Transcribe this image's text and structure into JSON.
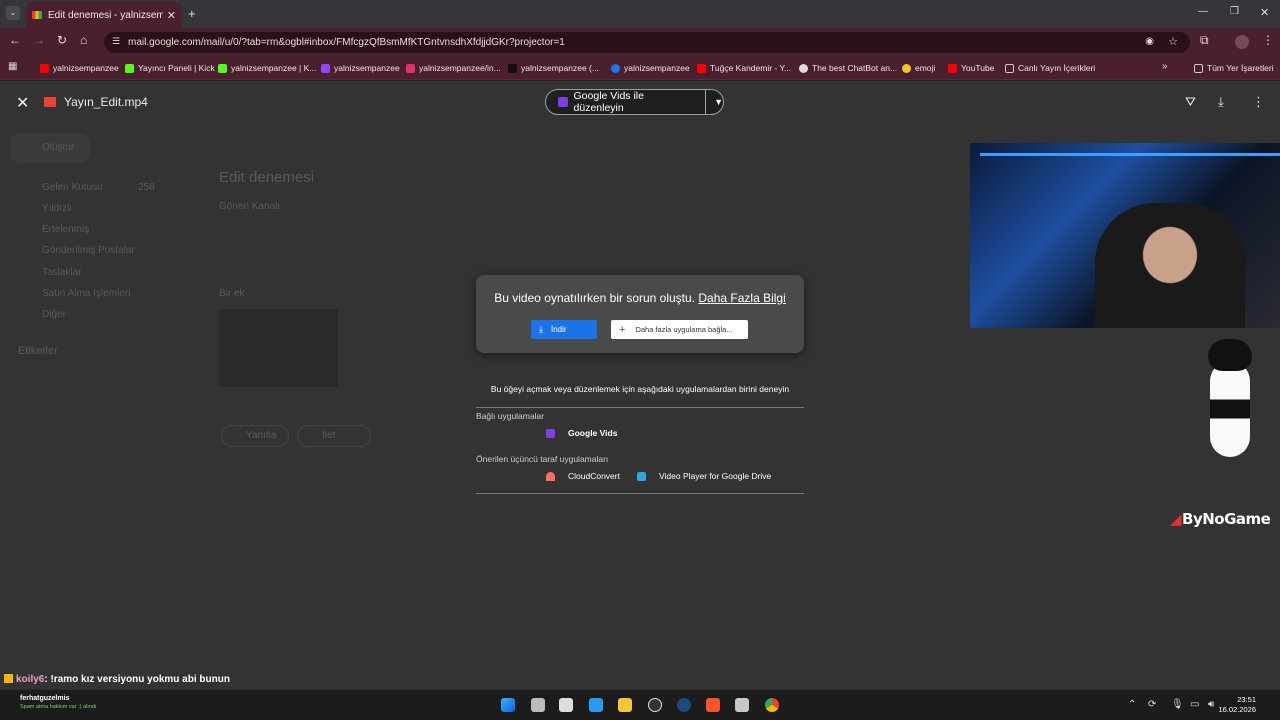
{
  "browser": {
    "tab_title": "Edit denemesi - yalnizsempanz",
    "url": "mail.google.com/mail/u/0/?tab=rm&ogbl#inbox/FMfcgzQfBsmMfKTGntvnsdhXfdjjdGKr?projector=1",
    "bookmarks": [
      {
        "label": "yalnizsempanzee",
        "color": "#ff0000"
      },
      {
        "label": "Yayıncı Paneli | Kick",
        "color": "#53fc18"
      },
      {
        "label": "yalnizsempanzee | K...",
        "color": "#53fc18"
      },
      {
        "label": "yalnizsempanzee",
        "color": "#9146ff"
      },
      {
        "label": "yalnizsempanzee/in...",
        "color": "#e1306c"
      },
      {
        "label": "yalnizsempanzee (...",
        "color": "#111111"
      },
      {
        "label": "yalnizsempanzee",
        "color": "#1877f2"
      },
      {
        "label": "Tuğçe Kandemir - Y...",
        "color": "#ff0000"
      },
      {
        "label": "The best ChatBot an...",
        "color": "#dddddd"
      },
      {
        "label": "emoji",
        "color": "#f5c518"
      },
      {
        "label": "YouTube",
        "color": "#ff0000"
      },
      {
        "label": "Canlı Yayın İçerikleri",
        "color": "#cccccc"
      }
    ],
    "all_bookmarks": "Tüm Yer İşaretleri"
  },
  "gmail_bg": {
    "compose": "Oluştur",
    "nav": [
      "Gelen Kutusu",
      "Yıldızlı",
      "Ertelenmiş",
      "Gönderilmiş Postalar",
      "Taslaklar",
      "Satın Alma İşlemleri",
      "Diğer"
    ],
    "inbox_count": "258",
    "labels": "Etiketler",
    "subject": "Edit denemesi",
    "sender": "Gönen Kanalı",
    "attachment_line": "Bir ek",
    "reply": "Yanıtla",
    "forward": "İlet"
  },
  "viewer": {
    "file_name": "Yayın_Edit.mp4",
    "open_with": "Google Vids ile düzenleyin",
    "error_message": "Bu video oynatılırken bir sorun oluştu.",
    "error_link": "Daha Fazla Bilgi",
    "download_label": "İndir",
    "connect_label": "Daha fazla uygulama bağla...",
    "apps_prompt": "Bu öğeyi açmak veya düzenlemek için aşağıdaki uygulamalardan birini deneyin",
    "connected_apps_title": "Bağlı uygulamalar",
    "connected_apps": [
      {
        "label": "Google Vids",
        "color": "#7b3fe4"
      }
    ],
    "suggested_title": "Önerilen üçüncü taraf uygulamaları",
    "suggested_apps": [
      {
        "label": "CloudConvert",
        "color": "#ff6f61"
      },
      {
        "label": "Video Player for Google Drive",
        "color": "#29a9e1"
      }
    ]
  },
  "stream": {
    "logo": "ByNoGame",
    "chat_user": "koily6",
    "chat_message": ": !ramo kız versiyonu yokmu abi bunun"
  },
  "taskbar": {
    "notif_user": "ferhatguzelmis",
    "notif_text": "Spam atma hakkım var :) alındı",
    "time": "23:51",
    "date": "16.02.2026"
  }
}
